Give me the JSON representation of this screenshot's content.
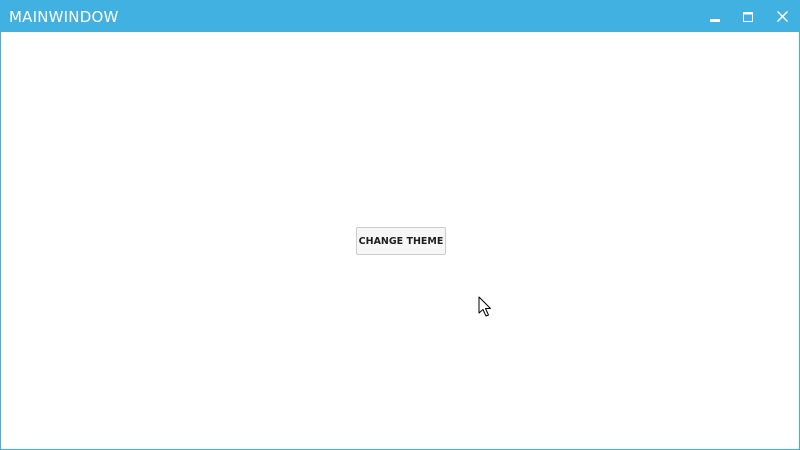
{
  "window": {
    "title": "MAINWINDOW",
    "accent_color": "#41b1e1",
    "controls": {
      "minimize_icon": "minimize-icon",
      "maximize_icon": "maximize-icon",
      "close_icon": "close-icon"
    }
  },
  "main": {
    "change_theme_label": "CHANGE THEME"
  },
  "cursor": {
    "icon": "arrow-cursor-icon"
  }
}
